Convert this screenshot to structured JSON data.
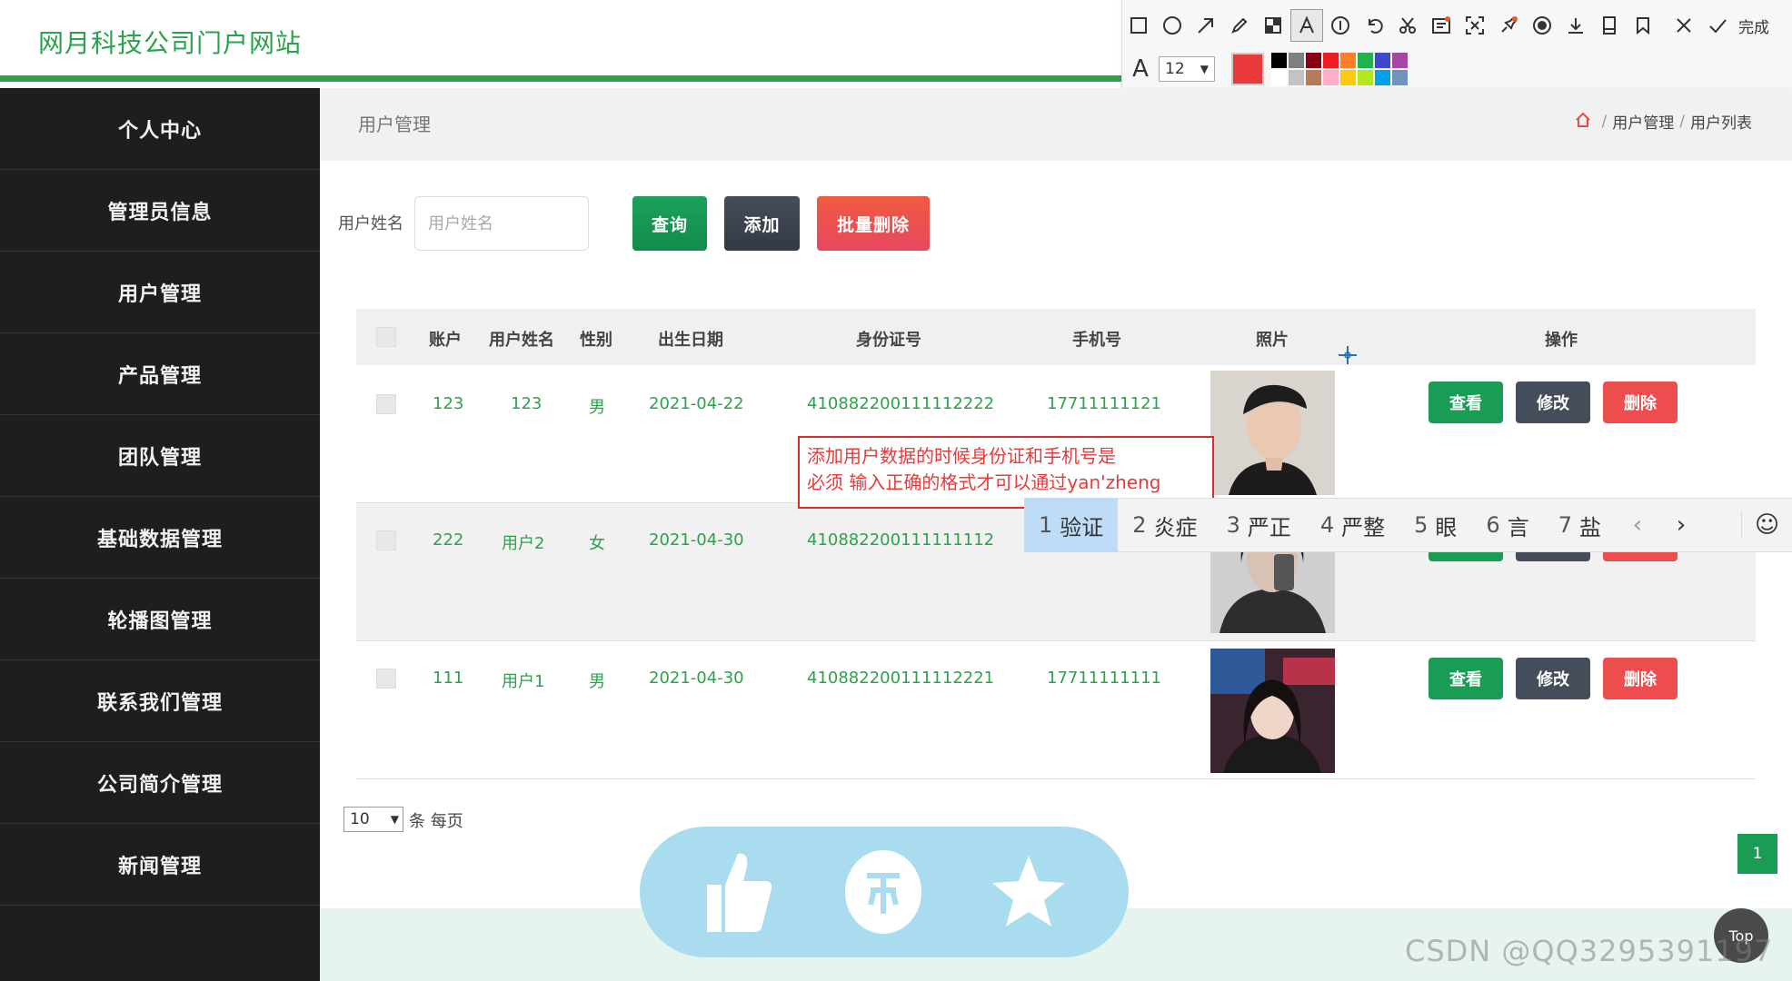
{
  "header": {
    "title": "网月科技公司门户网站"
  },
  "toolbar": {
    "tools": [
      "rectangle-icon",
      "ellipse-icon",
      "arrow-icon",
      "pencil-icon",
      "mosaic-icon",
      "text-icon",
      "number-icon",
      "undo-icon",
      "cut-icon",
      "ocr-icon",
      "screen-capture-icon",
      "pin-icon",
      "record-icon",
      "download-icon",
      "save-icon",
      "bookmark-icon",
      "close-icon"
    ],
    "finish_label": "完成",
    "font_glyph": "A",
    "font_size": "12",
    "current_color": "#e83a3a",
    "palette": [
      "#000000",
      "#7f7f7f",
      "#880015",
      "#ed1c24",
      "#ff7f27",
      "#22b14c",
      "#3f48cc",
      "#a349a4",
      "#ffffff",
      "#c3c3c3",
      "#b97a57",
      "#ffaec9",
      "#ffc90e",
      "#b5e61d",
      "#00a2e8",
      "#7092be"
    ]
  },
  "sidebar": {
    "items": [
      {
        "label": "个人中心"
      },
      {
        "label": "管理员信息"
      },
      {
        "label": "用户管理"
      },
      {
        "label": "产品管理"
      },
      {
        "label": "团队管理"
      },
      {
        "label": "基础数据管理"
      },
      {
        "label": "轮播图管理"
      },
      {
        "label": "联系我们管理"
      },
      {
        "label": "公司简介管理"
      },
      {
        "label": "新闻管理"
      }
    ]
  },
  "breadcrumb": {
    "title": "用户管理",
    "path": [
      "用户管理",
      "用户列表"
    ],
    "separator": "/"
  },
  "search": {
    "label": "用户姓名",
    "placeholder": "用户姓名",
    "query_label": "查询",
    "add_label": "添加",
    "batch_delete_label": "批量删除"
  },
  "table": {
    "headers": {
      "account": "账户",
      "name": "用户姓名",
      "gender": "性别",
      "birth": "出生日期",
      "idcard": "身份证号",
      "phone": "手机号",
      "photo": "照片",
      "ops": "操作"
    },
    "rows": [
      {
        "account": "123",
        "name": "123",
        "gender": "男",
        "birth": "2021-04-22",
        "idcard": "410882200111112222",
        "phone": "17711111121"
      },
      {
        "account": "222",
        "name": "用户2",
        "gender": "女",
        "birth": "2021-04-30",
        "idcard": "410882200111111112",
        "phone": ""
      },
      {
        "account": "111",
        "name": "用户1",
        "gender": "男",
        "birth": "2021-04-30",
        "idcard": "410882200111112221",
        "phone": "17711111111"
      }
    ],
    "ops": {
      "view": "查看",
      "edit": "修改",
      "delete": "删除"
    }
  },
  "annotation": {
    "line1": "添加用户数据的时候身份证和手机号是",
    "line2": "必须 输入正确的格式才可以通过yan'zheng"
  },
  "ime": {
    "candidates": [
      {
        "n": "1",
        "text": "验证"
      },
      {
        "n": "2",
        "text": "炎症"
      },
      {
        "n": "3",
        "text": "严正"
      },
      {
        "n": "4",
        "text": "严整"
      },
      {
        "n": "5",
        "text": "眼"
      },
      {
        "n": "6",
        "text": "言"
      },
      {
        "n": "7",
        "text": "盐"
      }
    ],
    "prev": "‹",
    "next": "›",
    "emoji": "☺"
  },
  "pagination": {
    "per_page": "10",
    "per_page_label": "条 每页",
    "current_page": "1"
  },
  "top_button": "Top",
  "watermark": "CSDN @QQ3295391197"
}
